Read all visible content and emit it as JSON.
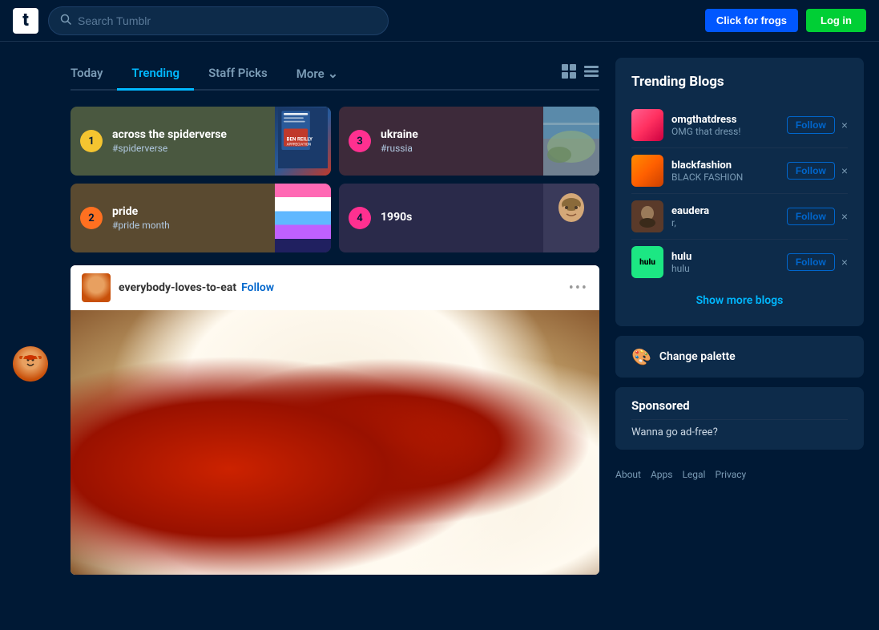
{
  "header": {
    "logo_letter": "t",
    "search_placeholder": "Search Tumblr",
    "frogs_button": "Click for frogs",
    "login_button": "Log in"
  },
  "tabs": {
    "items": [
      {
        "id": "today",
        "label": "Today",
        "active": false
      },
      {
        "id": "trending",
        "label": "Trending",
        "active": true
      },
      {
        "id": "staff-picks",
        "label": "Staff Picks",
        "active": false
      }
    ],
    "more_label": "More"
  },
  "trending": {
    "items": [
      {
        "rank": "1",
        "title": "across the spiderverse",
        "subtitle": "#spiderverse",
        "num_class": "num-yellow",
        "card_class": "trend-card-1",
        "img_type": "img1"
      },
      {
        "rank": "3",
        "title": "ukraine",
        "subtitle": "#russia",
        "num_class": "num-pink",
        "card_class": "trend-card-3",
        "img_type": "img2"
      },
      {
        "rank": "2",
        "title": "pride",
        "subtitle": "#pride month",
        "num_class": "num-orange",
        "card_class": "trend-card-2",
        "img_type": "pride"
      },
      {
        "rank": "4",
        "title": "1990s",
        "subtitle": "",
        "num_class": "num-pink2",
        "card_class": "trend-card-4",
        "img_type": "person"
      }
    ]
  },
  "post": {
    "username": "everybody-loves-to-eat",
    "follow_label": "Follow",
    "menu_dots": "•••"
  },
  "trending_blogs": {
    "title": "Trending Blogs",
    "blogs": [
      {
        "id": "omgthatdress",
        "name": "omgthatdress",
        "desc": "OMG that dress!",
        "avatar_class": "blog-avatar-omg"
      },
      {
        "id": "blackfashion",
        "name": "blackfashion",
        "desc": "BLACK FASHION",
        "avatar_class": "blog-avatar-black"
      },
      {
        "id": "eaudera",
        "name": "eaudera",
        "desc": "r,",
        "avatar_class": "blog-avatar-eau"
      },
      {
        "id": "hulu",
        "name": "hulu",
        "desc": "hulu",
        "avatar_class": "blog-avatar-hulu",
        "hulu_text": "hulu"
      }
    ],
    "follow_label": "Follow",
    "dismiss_label": "×",
    "show_more_label": "Show more blogs"
  },
  "change_palette": {
    "label": "Change palette",
    "icon": "🎨"
  },
  "sponsored": {
    "title": "Sponsored",
    "text": "Wanna go ad-free?"
  },
  "footer": {
    "links": [
      {
        "id": "about",
        "label": "About"
      },
      {
        "id": "apps",
        "label": "Apps"
      },
      {
        "id": "legal",
        "label": "Legal"
      },
      {
        "id": "privacy",
        "label": "Privacy"
      }
    ]
  }
}
